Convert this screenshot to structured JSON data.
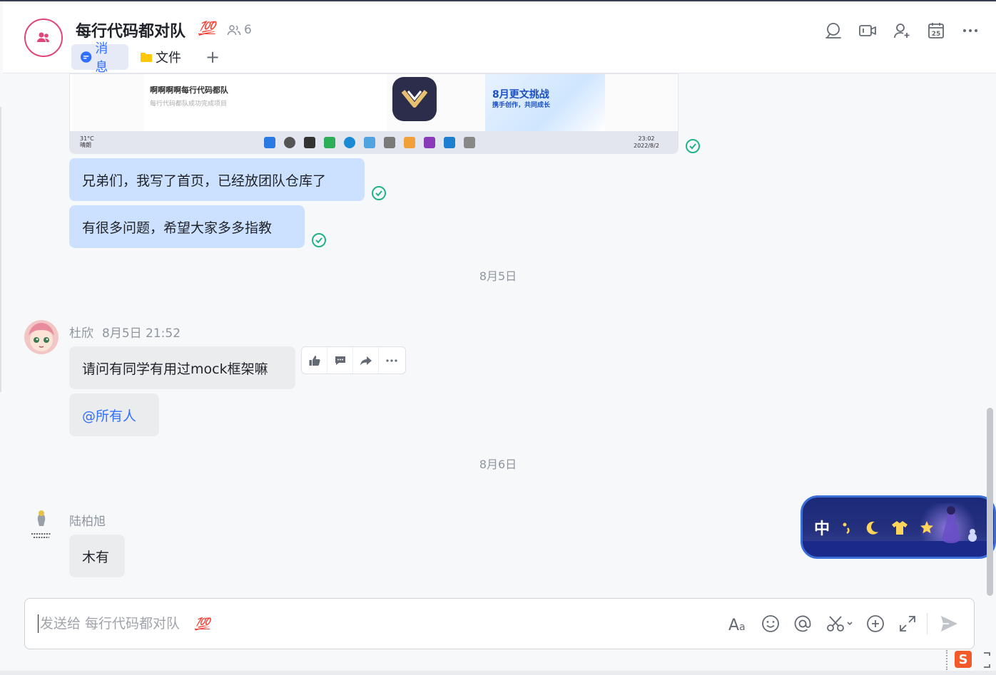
{
  "header": {
    "title": "每行代码都对队",
    "title_emoji": "💯",
    "member_count": "6",
    "tabs": [
      {
        "label": "消息"
      },
      {
        "label": "文件"
      }
    ]
  },
  "screenshot_preview": {
    "line1": "啊啊啊啊每行代码都队",
    "line2": "每行代码都队成功完成项目",
    "banner_title": "8月更文挑战",
    "banner_sub": "携手创作，共同成长",
    "weather_temp": "31°C",
    "weather_desc": "晴朗",
    "clock_time": "23:02",
    "clock_date": "2022/8/2"
  },
  "messages": [
    {
      "text": "兄弟们，我写了首页，已经放团队仓库了"
    },
    {
      "text": "有很多问题，希望大家多多指教"
    }
  ],
  "date_separators": [
    "8月5日",
    "8月6日"
  ],
  "thread1": {
    "sender": "杜欣",
    "time": "8月5日 21:52",
    "messages": [
      "请问有同学有用过mock框架嘛",
      "@所有人"
    ]
  },
  "thread2": {
    "sender": "陆柏旭",
    "messages": [
      "木有"
    ]
  },
  "ime_widget": {
    "label": "中"
  },
  "composer": {
    "placeholder": "发送给 每行代码都对队",
    "placeholder_emoji": "💯"
  },
  "colors": {
    "accent": "#3370ff",
    "mine_bubble": "#cce0ff",
    "other_bubble": "#ebecee",
    "read_check": "#20b288",
    "group_avatar_ring": "#e0457b"
  }
}
